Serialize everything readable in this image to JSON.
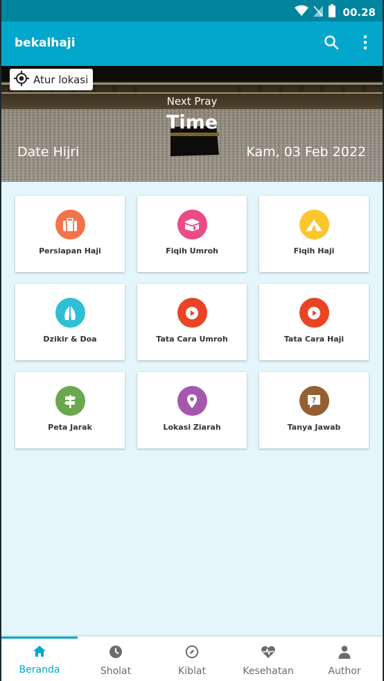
{
  "status": {
    "time": "00.28"
  },
  "app": {
    "title": "bekalhaji"
  },
  "hero": {
    "location_button": "Atur lokasi",
    "next_pray_label": "Next Pray",
    "time": "Time",
    "date_hijri": "Date Hijri",
    "date_gregorian": "Kam, 03 Feb 2022"
  },
  "menu": [
    {
      "label": "Persiapan Haji",
      "icon": "suitcase-icon",
      "color": "#f4734b"
    },
    {
      "label": "Fiqih Umroh",
      "icon": "kaaba-icon",
      "color": "#ec4b86"
    },
    {
      "label": "Fiqih Haji",
      "icon": "tent-icon",
      "color": "#fcc72e"
    },
    {
      "label": "Dzikir & Doa",
      "icon": "praying-hands-icon",
      "color": "#2ebfd6"
    },
    {
      "label": "Tata Cara Umroh",
      "icon": "play-icon",
      "color": "#ea4426"
    },
    {
      "label": "Tata Cara Haji",
      "icon": "play-icon",
      "color": "#ea4426"
    },
    {
      "label": "Peta Jarak",
      "icon": "signpost-icon",
      "color": "#6aa84f"
    },
    {
      "label": "Lokasi Ziarah",
      "icon": "map-pin-icon",
      "color": "#a557ad"
    },
    {
      "label": "Tanya Jawab",
      "icon": "question-bubble-icon",
      "color": "#935f33"
    }
  ],
  "bottom_nav": [
    {
      "label": "Beranda",
      "icon": "home-icon",
      "active": true
    },
    {
      "label": "Sholat",
      "icon": "clock-icon",
      "active": false
    },
    {
      "label": "Kiblat",
      "icon": "compass-icon",
      "active": false
    },
    {
      "label": "Kesehatan",
      "icon": "heart-pulse-icon",
      "active": false
    },
    {
      "label": "Author",
      "icon": "person-icon",
      "active": false
    }
  ],
  "colors": {
    "primary": "#04a7cc",
    "status_bar": "#01849e",
    "background": "#e4f6fb"
  }
}
